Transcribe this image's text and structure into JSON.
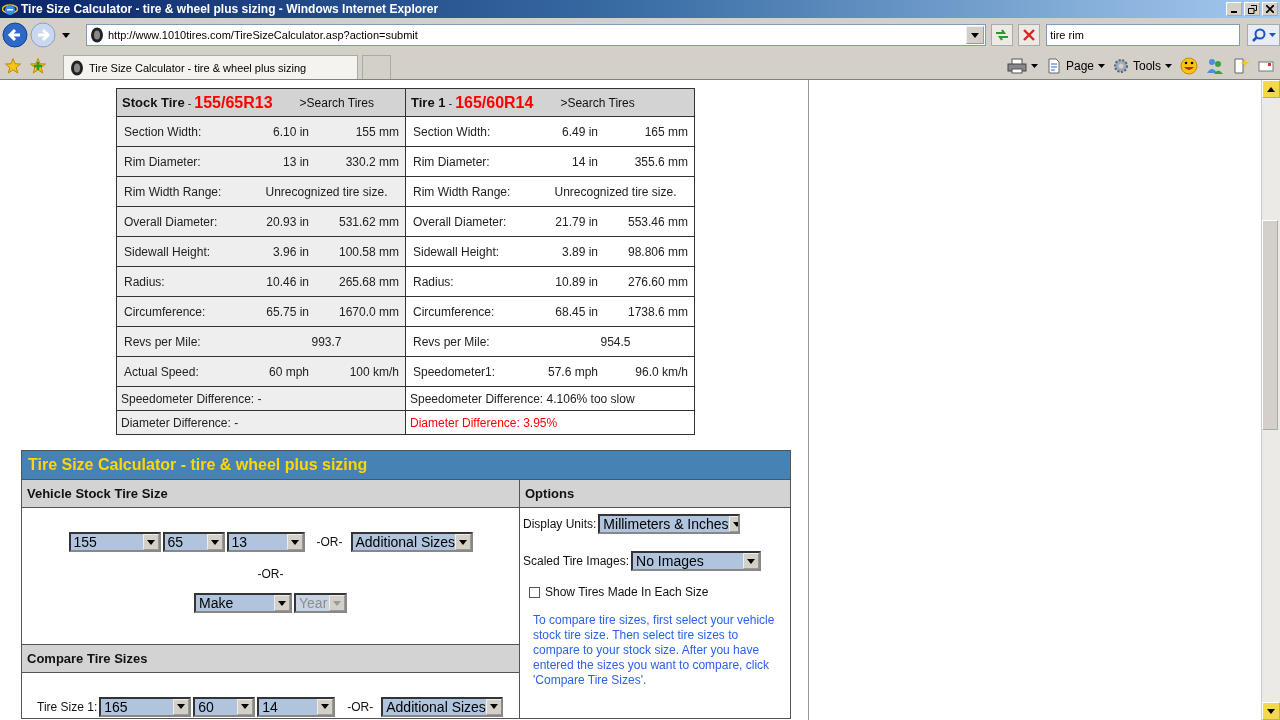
{
  "window": {
    "title": "Tire Size Calculator - tire & wheel plus sizing - Windows Internet Explorer"
  },
  "address_bar": {
    "url": "http://www.1010tires.com/TireSizeCalculator.asp?action=submit"
  },
  "search_box": {
    "value": "tire rim"
  },
  "tabs": [
    {
      "label": "Tire Size Calculator - tire & wheel plus sizing",
      "selected": true
    }
  ],
  "command_bar": {
    "items": [
      {
        "label": "Page"
      },
      {
        "label": "Tools"
      }
    ]
  },
  "comparison": {
    "tires": [
      {
        "name": "Stock Tire",
        "separator": "-",
        "size": "155/65R13",
        "link": ">Search Tires",
        "rows": [
          {
            "label": "Section Width:",
            "values": [
              "6.10 in",
              "155 mm"
            ]
          },
          {
            "label": "Rim Diameter:",
            "values": [
              "13 in",
              "330.2 mm"
            ]
          },
          {
            "label": "Rim Width Range:",
            "values": [
              "Unrecognized tire size."
            ]
          },
          {
            "label": "Overall Diameter:",
            "values": [
              "20.93 in",
              "531.62 mm"
            ]
          },
          {
            "label": "Sidewall Height:",
            "values": [
              "3.96 in",
              "100.58 mm"
            ]
          },
          {
            "label": "Radius:",
            "values": [
              "10.46 in",
              "265.68 mm"
            ]
          },
          {
            "label": "Circumference:",
            "values": [
              "65.75 in",
              "1670.0 mm"
            ]
          },
          {
            "label": "Revs per Mile:",
            "values": [
              "993.7"
            ]
          },
          {
            "label": "Actual Speed:",
            "values": [
              "60 mph",
              "100 km/h"
            ]
          }
        ],
        "speedometer_difference": "Speedometer Difference: -",
        "diameter_difference": {
          "text": "Diameter Difference: -",
          "alert": false
        }
      },
      {
        "name": "Tire 1",
        "separator": "-",
        "size": "165/60R14",
        "link": ">Search Tires",
        "rows": [
          {
            "label": "Section Width:",
            "values": [
              "6.49 in",
              "165 mm"
            ]
          },
          {
            "label": "Rim Diameter:",
            "values": [
              "14 in",
              "355.6 mm"
            ]
          },
          {
            "label": "Rim Width Range:",
            "values": [
              "Unrecognized tire size."
            ]
          },
          {
            "label": "Overall Diameter:",
            "values": [
              "21.79 in",
              "553.46 mm"
            ]
          },
          {
            "label": "Sidewall Height:",
            "values": [
              "3.89 in",
              "98.806 mm"
            ]
          },
          {
            "label": "Radius:",
            "values": [
              "10.89 in",
              "276.60 mm"
            ]
          },
          {
            "label": "Circumference:",
            "values": [
              "68.45 in",
              "1738.6 mm"
            ]
          },
          {
            "label": "Revs per Mile:",
            "values": [
              "954.5"
            ]
          },
          {
            "label": "Speedometer1:",
            "values": [
              "57.6 mph",
              "96.0 km/h"
            ]
          }
        ],
        "speedometer_difference": "Speedometer Difference: 4.106% too slow",
        "diameter_difference": {
          "text": "Diameter Difference: 3.95%",
          "alert": true
        }
      }
    ]
  },
  "calculator": {
    "title": "Tire Size Calculator - tire & wheel plus sizing",
    "vehicle": {
      "heading": "Vehicle Stock Tire Size",
      "size_selects": [
        {
          "value": "155",
          "disabled": false
        },
        {
          "value": "65",
          "disabled": false
        },
        {
          "value": "13",
          "disabled": false
        }
      ],
      "or_1": "-OR-",
      "additional": {
        "value": "Additional Sizes",
        "disabled": false
      },
      "or_2": "-OR-",
      "vehicle_selects": [
        {
          "value": "Make",
          "disabled": false
        },
        {
          "value": "Year",
          "disabled": true
        }
      ]
    },
    "compare": {
      "heading": "Compare Tire Sizes",
      "rows": [
        {
          "label": "Tire Size 1:",
          "selects": [
            {
              "value": "165",
              "disabled": false
            },
            {
              "value": "60",
              "disabled": false
            },
            {
              "value": "14",
              "disabled": false
            }
          ],
          "or": "-OR-",
          "additional": {
            "value": "Additional Sizes",
            "disabled": false
          }
        }
      ]
    },
    "options": {
      "heading": "Options",
      "display_units": {
        "label": "Display Units:",
        "value": "Millimeters & Inches"
      },
      "scaled_images": {
        "label": "Scaled Tire Images:",
        "value": "No Images"
      },
      "show_tires": {
        "label": "Show Tires Made In Each Size",
        "checked": false
      },
      "help": "To compare tire sizes, first select your vehicle stock tire size. Then select tire sizes to compare to your stock size. After you have entered the sizes you want to compare, click 'Compare Tire Sizes'."
    }
  }
}
